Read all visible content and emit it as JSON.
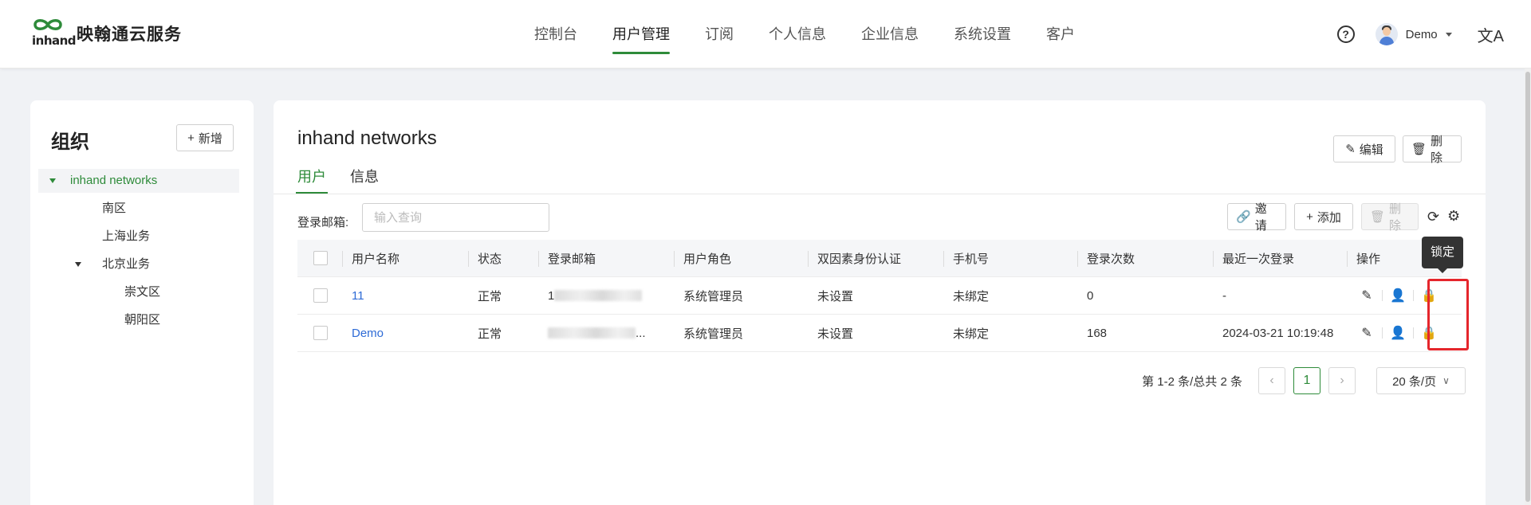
{
  "header": {
    "brand_logo_text": "inhand",
    "brand_name": "映翰通云服务",
    "nav": [
      {
        "label": "控制台",
        "active": false
      },
      {
        "label": "用户管理",
        "active": true
      },
      {
        "label": "订阅",
        "active": false
      },
      {
        "label": "个人信息",
        "active": false
      },
      {
        "label": "企业信息",
        "active": false
      },
      {
        "label": "系统设置",
        "active": false
      },
      {
        "label": "客户",
        "active": false
      }
    ],
    "help_glyph": "?",
    "user_name": "Demo",
    "lang_glyph": "文A"
  },
  "org_panel": {
    "title": "组织",
    "add_label": "新增",
    "tree": [
      {
        "label": "inhand networks",
        "level": 0,
        "expanded": true,
        "selected": true
      },
      {
        "label": "南区",
        "level": 1
      },
      {
        "label": "上海业务",
        "level": 1
      },
      {
        "label": "北京业务",
        "level": 1,
        "expanded": true
      },
      {
        "label": "崇文区",
        "level": 2
      },
      {
        "label": "朝阳区",
        "level": 2
      }
    ]
  },
  "main": {
    "title": "inhand networks",
    "edit_label": "编辑",
    "delete_label": "删除",
    "tabs": [
      {
        "label": "用户",
        "active": true
      },
      {
        "label": "信息",
        "active": false
      }
    ],
    "filter": {
      "label": "登录邮箱:",
      "placeholder": "输入查询"
    },
    "toolbar": {
      "invite_label": "邀请",
      "add_label": "添加",
      "delete_label": "删除"
    },
    "table": {
      "columns": [
        "用户名称",
        "状态",
        "登录邮箱",
        "用户角色",
        "双因素身份认证",
        "手机号",
        "登录次数",
        "最近一次登录",
        "操作"
      ],
      "rows": [
        {
          "name": "11",
          "status": "正常",
          "email": "1",
          "role": "系统管理员",
          "mfa": "未设置",
          "phone": "未绑定",
          "login_count": "0",
          "last_login": "-",
          "locked_enabled": true
        },
        {
          "name": "Demo",
          "status": "正常",
          "email": "...",
          "role": "系统管理员",
          "mfa": "未设置",
          "phone": "未绑定",
          "login_count": "168",
          "last_login": "2024-03-21 10:19:48",
          "locked_enabled": false
        }
      ]
    },
    "tooltip": "锁定",
    "pagination": {
      "info": "第 1-2 条/总共 2 条",
      "current_page": "1",
      "page_size": "20 条/页"
    }
  },
  "colors": {
    "accent": "#2e8b3a",
    "link": "#2e6bd6",
    "lock": "#2e5ccc",
    "highlight": "#e5262c"
  }
}
